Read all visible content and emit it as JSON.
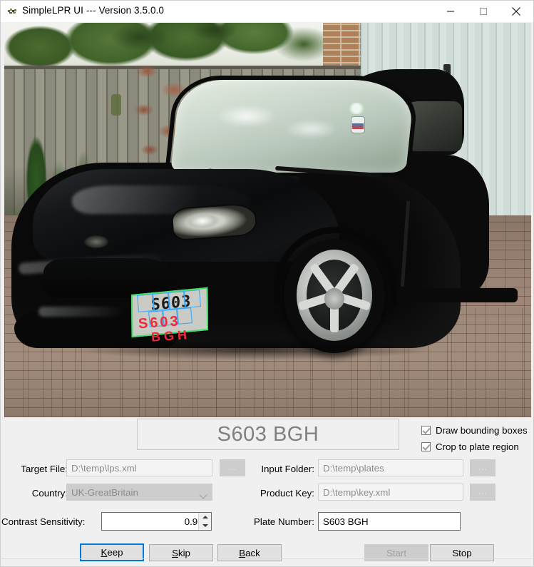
{
  "window": {
    "title": "SimpleLPR UI --- Version 3.5.0.0",
    "app_icon": "simplelpr-app-icon",
    "minimize_label": "—",
    "maximize_label": "□",
    "close_label": "✕"
  },
  "photo": {
    "description": "Black Mazda MX-5 convertible parked on block-paved driveway beside white garage door, wooden fence and trees behind",
    "detection": {
      "plate_text": "S603 BGH",
      "overlay_line1": "S603",
      "overlay_line2": "BGH",
      "quad_color": "#41e06a",
      "char_box_color": "#2fa8ff",
      "overlay_text_color": "#f0283c"
    }
  },
  "panel": {
    "plate_display": "S603 BGH",
    "checkboxes": [
      {
        "label": "Draw bounding boxes",
        "checked": true
      },
      {
        "label": "Crop to plate region",
        "checked": true
      }
    ],
    "fields": {
      "target_file": {
        "label": "Target File:",
        "value": "D:\\temp\\lps.xml",
        "browse": "...",
        "enabled": false
      },
      "country": {
        "label": "Country:",
        "value": "UK-GreatBritain",
        "enabled": false
      },
      "contrast_sensitivity": {
        "label": "Contrast Sensitivity:",
        "value": "0.918",
        "enabled": true
      },
      "input_folder": {
        "label": "Input Folder:",
        "value": "D:\\temp\\plates",
        "browse": "...",
        "enabled": false
      },
      "product_key": {
        "label": "Product Key:",
        "value": "D:\\temp\\key.xml",
        "browse": "...",
        "enabled": false
      },
      "plate_number": {
        "label": "Plate Number:",
        "value": "S603 BGH",
        "enabled": true
      }
    },
    "buttons": {
      "keep": {
        "prefix": "",
        "mnemonic": "K",
        "suffix": "eep",
        "focused": true,
        "enabled": true
      },
      "skip": {
        "prefix": "",
        "mnemonic": "S",
        "suffix": "kip",
        "focused": false,
        "enabled": true
      },
      "back": {
        "prefix": "",
        "mnemonic": "B",
        "suffix": "ack",
        "focused": false,
        "enabled": true
      },
      "start": {
        "label": "Start",
        "enabled": false
      },
      "stop": {
        "label": "Stop",
        "enabled": true
      }
    }
  },
  "colors": {
    "panel_bg": "#f0f0f0",
    "focus_blue": "#0078d7",
    "disabled_text": "#a0a0a0",
    "plate_display_text": "#808080"
  }
}
